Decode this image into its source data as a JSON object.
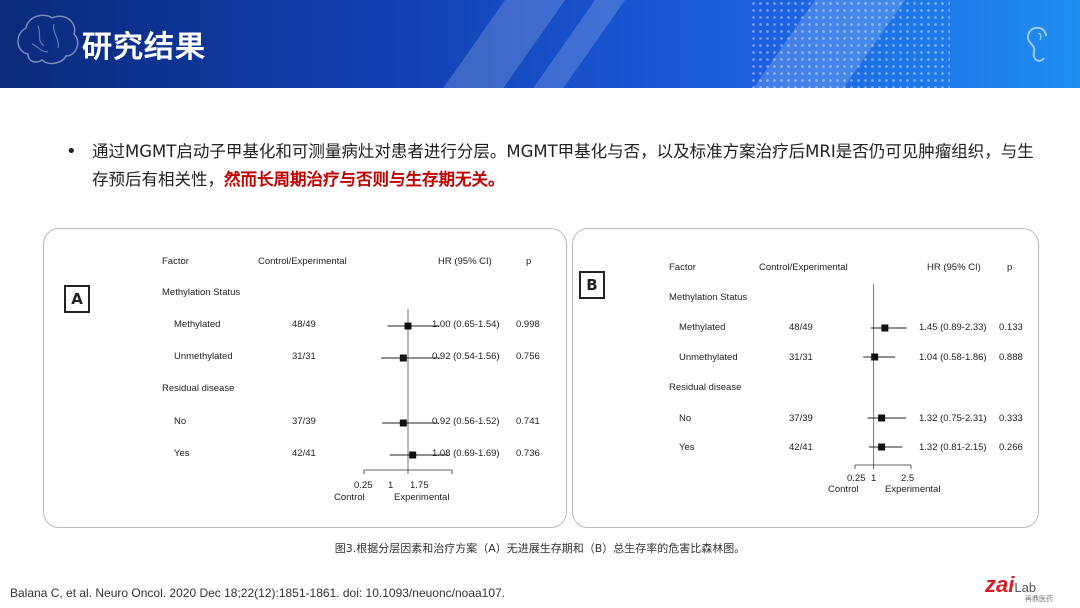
{
  "header": {
    "title": "研究结果"
  },
  "body": {
    "text_normal": "通过MGMT启动子甲基化和可测量病灶对患者进行分层。MGMT甲基化与否，以及标准方案治疗后MRI是否仍可见肿瘤组织，与生存预后有相关性，",
    "text_highlight": "然而长周期治疗与否则与生存期无关。"
  },
  "panel_a": {
    "label": "A",
    "headers": {
      "factor": "Factor",
      "ce": "Control/Experimental",
      "hr": "HR (95% CI)",
      "p": "p"
    },
    "groups": [
      "Methylation Status",
      "Residual disease"
    ],
    "rows": [
      {
        "name": "Methylated",
        "ce": "48/49",
        "hr": "1.00 (0.65-1.54)",
        "p": "0.998"
      },
      {
        "name": "Unmethylated",
        "ce": "31/31",
        "hr": "0.92 (0.54-1.56)",
        "p": "0.756"
      },
      {
        "name": "No",
        "ce": "37/39",
        "hr": "0.92 (0.56-1.52)",
        "p": "0.741"
      },
      {
        "name": "Yes",
        "ce": "42/41",
        "hr": "1.08 (0.69-1.69)",
        "p": "0.736"
      }
    ],
    "axis_ticks": [
      "0.25",
      "1",
      "1.75"
    ],
    "axis_left": "Control",
    "axis_right": "Experimental"
  },
  "panel_b": {
    "label": "B",
    "headers": {
      "factor": "Factor",
      "ce": "Control/Experimental",
      "hr": "HR (95% CI)",
      "p": "p"
    },
    "groups": [
      "Methylation Status",
      "Residual disease"
    ],
    "rows": [
      {
        "name": "Methylated",
        "ce": "48/49",
        "hr": "1.45 (0.89-2.33)",
        "p": "0.133"
      },
      {
        "name": "Unmethylated",
        "ce": "31/31",
        "hr": "1.04 (0.58-1.86)",
        "p": "0.888"
      },
      {
        "name": "No",
        "ce": "37/39",
        "hr": "1.32 (0.75-2.31)",
        "p": "0.333"
      },
      {
        "name": "Yes",
        "ce": "42/41",
        "hr": "1.32 (0.81-2.15)",
        "p": "0.266"
      }
    ],
    "axis_ticks": [
      "0.25",
      "1",
      "2.5"
    ],
    "axis_left": "Control",
    "axis_right": "Experimental"
  },
  "caption": "图3.根据分层因素和治疗方案（A）无进展生存期和（B）总生存率的危害比森林图。",
  "reference": "Balana C, et al. Neuro Oncol. 2020 Dec 18;22(12):1851-1861. doi: 10.1093/neuonc/noaa107.",
  "logo": {
    "main": "zai",
    "suffix": "Lab",
    "sub": "再鼎医药"
  },
  "chart_data": [
    {
      "type": "forest",
      "panel": "A",
      "xlim": [
        0.25,
        1.75
      ],
      "reference_line": 1,
      "rows": [
        {
          "label": "Methylated",
          "hr": 1.0,
          "lo": 0.65,
          "hi": 1.54
        },
        {
          "label": "Unmethylated",
          "hr": 0.92,
          "lo": 0.54,
          "hi": 1.56
        },
        {
          "label": "No",
          "hr": 0.92,
          "lo": 0.56,
          "hi": 1.52
        },
        {
          "label": "Yes",
          "hr": 1.08,
          "lo": 0.69,
          "hi": 1.69
        }
      ]
    },
    {
      "type": "forest",
      "panel": "B",
      "xlim": [
        0.25,
        2.5
      ],
      "reference_line": 1,
      "rows": [
        {
          "label": "Methylated",
          "hr": 1.45,
          "lo": 0.89,
          "hi": 2.33
        },
        {
          "label": "Unmethylated",
          "hr": 1.04,
          "lo": 0.58,
          "hi": 1.86
        },
        {
          "label": "No",
          "hr": 1.32,
          "lo": 0.75,
          "hi": 2.31
        },
        {
          "label": "Yes",
          "hr": 1.32,
          "lo": 0.81,
          "hi": 2.15
        }
      ]
    }
  ]
}
